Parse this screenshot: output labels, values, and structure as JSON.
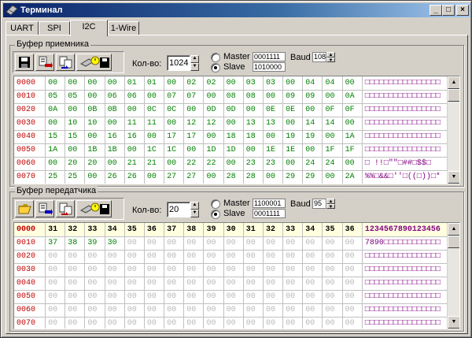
{
  "window": {
    "title": "Терминал",
    "cap_min": "_",
    "cap_max": "□",
    "cap_close": "×"
  },
  "tabs": [
    {
      "label": "UART"
    },
    {
      "label": "SPI"
    },
    {
      "label": "I2C"
    },
    {
      "label": "1-Wire"
    }
  ],
  "active_tab": "I2C",
  "receiver": {
    "title": "Буфер приемника",
    "count_label": "Кол-во:",
    "count_value": "1024",
    "master_label": "Master",
    "slave_label": "Slave",
    "master_addr": "0001111",
    "slave_addr": "1010000",
    "baud_label": "Baud",
    "baud_value": "108",
    "selected_mode": "Slave",
    "rows": [
      {
        "addr": "0000",
        "bytes": [
          "00",
          "00",
          "00",
          "00",
          "01",
          "01",
          "00",
          "02",
          "02",
          "00",
          "03",
          "03",
          "00",
          "04",
          "04",
          "00"
        ],
        "ascii": "□□□□□□□□□□□□□□□□"
      },
      {
        "addr": "0010",
        "bytes": [
          "05",
          "05",
          "00",
          "06",
          "06",
          "00",
          "07",
          "07",
          "00",
          "08",
          "08",
          "00",
          "09",
          "09",
          "00",
          "0A"
        ],
        "ascii": "□□□□□□□□□□□□□□□□"
      },
      {
        "addr": "0020",
        "bytes": [
          "0A",
          "00",
          "0B",
          "0B",
          "00",
          "0C",
          "0C",
          "00",
          "0D",
          "0D",
          "00",
          "0E",
          "0E",
          "00",
          "0F",
          "0F"
        ],
        "ascii": "□□□□□□□□□□□□□□□□"
      },
      {
        "addr": "0030",
        "bytes": [
          "00",
          "10",
          "10",
          "00",
          "11",
          "11",
          "00",
          "12",
          "12",
          "00",
          "13",
          "13",
          "00",
          "14",
          "14",
          "00"
        ],
        "ascii": "□□□□□□□□□□□□□□□□"
      },
      {
        "addr": "0040",
        "bytes": [
          "15",
          "15",
          "00",
          "16",
          "16",
          "00",
          "17",
          "17",
          "00",
          "18",
          "18",
          "00",
          "19",
          "19",
          "00",
          "1A"
        ],
        "ascii": "□□□□□□□□□□□□□□□□"
      },
      {
        "addr": "0050",
        "bytes": [
          "1A",
          "00",
          "1B",
          "1B",
          "00",
          "1C",
          "1C",
          "00",
          "1D",
          "1D",
          "00",
          "1E",
          "1E",
          "00",
          "1F",
          "1F"
        ],
        "ascii": "□□□□□□□□□□□□□□□□"
      },
      {
        "addr": "0060",
        "bytes": [
          "00",
          "20",
          "20",
          "00",
          "21",
          "21",
          "00",
          "22",
          "22",
          "00",
          "23",
          "23",
          "00",
          "24",
          "24",
          "00"
        ],
        "ascii": "□  !!□\"\"□##□$$□"
      },
      {
        "addr": "0070",
        "bytes": [
          "25",
          "25",
          "00",
          "26",
          "26",
          "00",
          "27",
          "27",
          "00",
          "28",
          "28",
          "00",
          "29",
          "29",
          "00",
          "2A"
        ],
        "ascii": "%%□&&□''□((□))□*"
      }
    ]
  },
  "transmitter": {
    "title": "Буфер передатчика",
    "count_label": "Кол-во:",
    "count_value": "20",
    "master_label": "Master",
    "slave_label": "Slave",
    "master_addr": "1100001",
    "slave_addr": "0001111",
    "baud_label": "Baud",
    "baud_value": "95",
    "selected_mode": "Slave",
    "rows": [
      {
        "addr": "0000",
        "bytes": [
          "31",
          "32",
          "33",
          "34",
          "35",
          "36",
          "37",
          "38",
          "39",
          "30",
          "31",
          "32",
          "33",
          "34",
          "35",
          "36"
        ],
        "ascii": "1234567890123456"
      },
      {
        "addr": "0010",
        "bytes": [
          "37",
          "38",
          "39",
          "30",
          "00",
          "00",
          "00",
          "00",
          "00",
          "00",
          "00",
          "00",
          "00",
          "00",
          "00",
          "00"
        ],
        "ascii": "7890□□□□□□□□□□□□"
      },
      {
        "addr": "0020",
        "bytes": [
          "00",
          "00",
          "00",
          "00",
          "00",
          "00",
          "00",
          "00",
          "00",
          "00",
          "00",
          "00",
          "00",
          "00",
          "00",
          "00"
        ],
        "ascii": "□□□□□□□□□□□□□□□□"
      },
      {
        "addr": "0030",
        "bytes": [
          "00",
          "00",
          "00",
          "00",
          "00",
          "00",
          "00",
          "00",
          "00",
          "00",
          "00",
          "00",
          "00",
          "00",
          "00",
          "00"
        ],
        "ascii": "□□□□□□□□□□□□□□□□"
      },
      {
        "addr": "0040",
        "bytes": [
          "00",
          "00",
          "00",
          "00",
          "00",
          "00",
          "00",
          "00",
          "00",
          "00",
          "00",
          "00",
          "00",
          "00",
          "00",
          "00"
        ],
        "ascii": "□□□□□□□□□□□□□□□□"
      },
      {
        "addr": "0050",
        "bytes": [
          "00",
          "00",
          "00",
          "00",
          "00",
          "00",
          "00",
          "00",
          "00",
          "00",
          "00",
          "00",
          "00",
          "00",
          "00",
          "00"
        ],
        "ascii": "□□□□□□□□□□□□□□□□"
      },
      {
        "addr": "0060",
        "bytes": [
          "00",
          "00",
          "00",
          "00",
          "00",
          "00",
          "00",
          "00",
          "00",
          "00",
          "00",
          "00",
          "00",
          "00",
          "00",
          "00"
        ],
        "ascii": "□□□□□□□□□□□□□□□□"
      },
      {
        "addr": "0070",
        "bytes": [
          "00",
          "00",
          "00",
          "00",
          "00",
          "00",
          "00",
          "00",
          "00",
          "00",
          "00",
          "00",
          "00",
          "00",
          "00",
          "00"
        ],
        "ascii": "□□□□□□□□□□□□□□□□"
      }
    ]
  },
  "colors": {
    "title_bar": "#0a246a",
    "address": "#c00000",
    "byte": "#008000",
    "ascii": "#800080",
    "current_row": "#ffffe0"
  },
  "icons": [
    "save-icon",
    "receive-icon",
    "transfer-icon",
    "save-timer-icon",
    "open-folder-icon"
  ]
}
